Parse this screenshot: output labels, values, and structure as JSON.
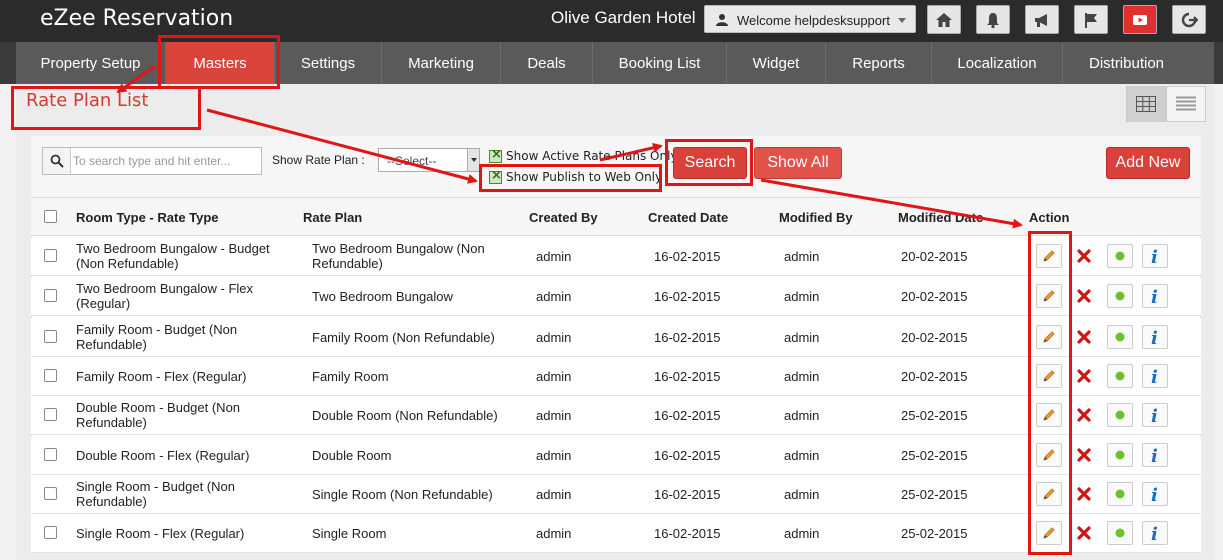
{
  "app": {
    "brand": "eZee Reservation",
    "hotel_name": "Olive Garden Hotel",
    "welcome_text": "Welcome helpdesksupport"
  },
  "toolbar_icons": [
    "home-icon",
    "bell-icon",
    "megaphone-icon",
    "flag-icon",
    "youtube-icon",
    "logout-icon"
  ],
  "nav": {
    "items": [
      {
        "label": "Property Setup"
      },
      {
        "label": "Masters",
        "active": true
      },
      {
        "label": "Settings"
      },
      {
        "label": "Marketing"
      },
      {
        "label": "Deals"
      },
      {
        "label": "Booking List"
      },
      {
        "label": "Widget"
      },
      {
        "label": "Reports"
      },
      {
        "label": "Localization"
      },
      {
        "label": "Distribution"
      }
    ]
  },
  "page": {
    "title": "Rate Plan List"
  },
  "filters": {
    "search_placeholder": "To search type and hit enter...",
    "show_rate_plan_label": "Show Rate Plan :",
    "rate_plan_selected": "--Select--",
    "active_only_label": "Show Active Rate Plans Only",
    "publish_web_label": "Show Publish to Web Only",
    "search_button": "Search",
    "show_all_button": "Show All",
    "add_new_button": "Add New"
  },
  "table": {
    "headers": {
      "room_type": "Room Type - Rate Type",
      "rate_plan": "Rate Plan",
      "created_by": "Created By",
      "created_date": "Created Date",
      "modified_by": "Modified By",
      "modified_date": "Modified Date",
      "action": "Action"
    },
    "rows": [
      {
        "room_type_1": "Two Bedroom Bungalow - Budget",
        "room_type_2": "(Non Refundable)",
        "rate_plan_1": "Two Bedroom Bungalow (Non",
        "rate_plan_2": "Refundable)",
        "created_by": "admin",
        "created_date": "16-02-2015",
        "modified_by": "admin",
        "modified_date": "20-02-2015"
      },
      {
        "room_type_1": "Two Bedroom Bungalow - Flex",
        "room_type_2": "(Regular)",
        "rate_plan_1": "Two Bedroom Bungalow",
        "rate_plan_2": "",
        "created_by": "admin",
        "created_date": "16-02-2015",
        "modified_by": "admin",
        "modified_date": "20-02-2015"
      },
      {
        "room_type_1": "Family Room - Budget (Non",
        "room_type_2": "Refundable)",
        "rate_plan_1": "Family Room (Non Refundable)",
        "rate_plan_2": "",
        "created_by": "admin",
        "created_date": "16-02-2015",
        "modified_by": "admin",
        "modified_date": "20-02-2015"
      },
      {
        "room_type_1": "Family Room - Flex (Regular)",
        "room_type_2": "",
        "rate_plan_1": "Family Room",
        "rate_plan_2": "",
        "created_by": "admin",
        "created_date": "16-02-2015",
        "modified_by": "admin",
        "modified_date": "20-02-2015"
      },
      {
        "room_type_1": "Double Room - Budget (Non",
        "room_type_2": "Refundable)",
        "rate_plan_1": "Double Room (Non Refundable)",
        "rate_plan_2": "",
        "created_by": "admin",
        "created_date": "16-02-2015",
        "modified_by": "admin",
        "modified_date": "25-02-2015"
      },
      {
        "room_type_1": "Double Room - Flex (Regular)",
        "room_type_2": "",
        "rate_plan_1": "Double Room",
        "rate_plan_2": "",
        "created_by": "admin",
        "created_date": "16-02-2015",
        "modified_by": "admin",
        "modified_date": "25-02-2015"
      },
      {
        "room_type_1": "Single Room - Budget (Non",
        "room_type_2": "Refundable)",
        "rate_plan_1": "Single Room (Non Refundable)",
        "rate_plan_2": "",
        "created_by": "admin",
        "created_date": "16-02-2015",
        "modified_by": "admin",
        "modified_date": "25-02-2015"
      },
      {
        "room_type_1": "Single Room - Flex (Regular)",
        "room_type_2": "",
        "rate_plan_1": "Single Room",
        "rate_plan_2": "",
        "created_by": "admin",
        "created_date": "16-02-2015",
        "modified_by": "admin",
        "modified_date": "25-02-2015"
      }
    ],
    "action_icons": [
      "edit-icon",
      "delete-icon",
      "status-active-icon",
      "info-icon"
    ]
  },
  "colors": {
    "accent_red": "#d9433a",
    "annotation_red": "#e01515",
    "topbar": "#2b2b2b",
    "navbar": "#5a5a5a"
  }
}
